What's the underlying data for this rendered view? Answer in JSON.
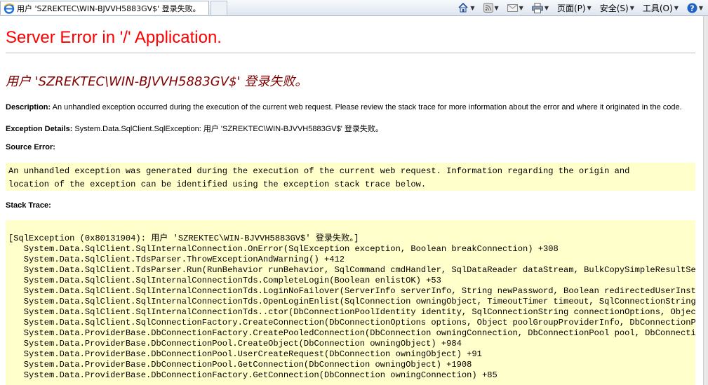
{
  "browser": {
    "tab_title": "用户 'SZREKTEC\\WIN-BJVVH5883GV$' 登录失败。",
    "commands": {
      "page": "页面(P)",
      "safety": "安全(S)",
      "tools": "工具(O)"
    }
  },
  "page": {
    "title": "Server Error in '/' Application.",
    "error_message": "用户 'SZREKTEC\\WIN-BJVVH5883GV$' 登录失败。",
    "description_label": "Description:",
    "description_text": " An unhandled exception occurred during the execution of the current web request. Please review the stack trace for more information about the error and where it originated in the code.",
    "exception_label": "Exception Details:",
    "exception_text": " System.Data.SqlClient.SqlException: 用户 'SZREKTEC\\WIN-BJVVH5883GV$' 登录失败。",
    "source_error_label": "Source Error:",
    "source_error_lines": [
      "An unhandled exception was generated during the execution of the current web request. Information regarding the origin and",
      "location of the exception can be identified using the exception stack trace below."
    ],
    "stack_trace_label": "Stack Trace:",
    "stack_trace_lines": [
      "[SqlException (0x80131904): 用户 'SZREKTEC\\WIN-BJVVH5883GV$' 登录失败。]",
      "   System.Data.SqlClient.SqlInternalConnection.OnError(SqlException exception, Boolean breakConnection) +308",
      "   System.Data.SqlClient.TdsParser.ThrowExceptionAndWarning() +412",
      "   System.Data.SqlClient.TdsParser.Run(RunBehavior runBehavior, SqlCommand cmdHandler, SqlDataReader dataStream, BulkCopySimpleResultSet bulkCopyHandler",
      "   System.Data.SqlClient.SqlInternalConnectionTds.CompleteLogin(Boolean enlistOK) +53",
      "   System.Data.SqlClient.SqlInternalConnectionTds.LoginNoFailover(ServerInfo serverInfo, String newPassword, Boolean redirectedUserInstance, SqlConnection",
      "   System.Data.SqlClient.SqlInternalConnectionTds.OpenLoginEnlist(SqlConnection owningObject, TimeoutTimer timeout, SqlConnectionString connectionOptions",
      "   System.Data.SqlClient.SqlInternalConnectionTds..ctor(DbConnectionPoolIdentity identity, SqlConnectionString connectionOptions, Object providerInfo",
      "   System.Data.SqlClient.SqlConnectionFactory.CreateConnection(DbConnectionOptions options, Object poolGroupProviderInfo, DbConnectionPool pool, DbConnection",
      "   System.Data.ProviderBase.DbConnectionFactory.CreatePooledConnection(DbConnection owningConnection, DbConnectionPool pool, DbConnectionOptions options",
      "   System.Data.ProviderBase.DbConnectionPool.CreateObject(DbConnection owningObject) +984",
      "   System.Data.ProviderBase.DbConnectionPool.UserCreateRequest(DbConnection owningObject) +91",
      "   System.Data.ProviderBase.DbConnectionPool.GetConnection(DbConnection owningObject) +1908",
      "   System.Data.ProviderBase.DbConnectionFactory.GetConnection(DbConnection owningConnection) +85"
    ]
  },
  "colors": {
    "title_red": "#ff0000",
    "subtitle_maroon": "#800000",
    "code_background": "#ffffcc"
  }
}
